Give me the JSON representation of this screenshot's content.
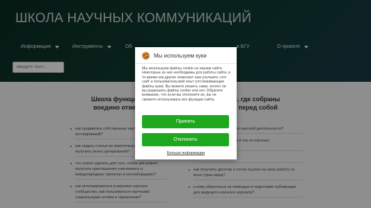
{
  "site": {
    "title": "ШКОЛА НАУЧНЫХ КОММУНИКАЦИЙ"
  },
  "nav": {
    "items": [
      {
        "label": "Информация"
      },
      {
        "label": "Инструменты"
      },
      {
        "label": "Об"
      },
      {
        "label": "в БГУ"
      },
      {
        "label": "О проекте"
      }
    ]
  },
  "search": {
    "placeholder": "Введите текст..."
  },
  "main": {
    "heading_line1": "Школа функциони                                          щник, где собраны",
    "heading_line2": "воедино ответы н                                          авит перед собой",
    "left_items": [
      "как продвигать собственные научные результаты исследований?",
      "как подать статью во влиятельный журнал и получить много цитирований?",
      "что нужно сделать для того, чтобы регулярно получать приглашения участвовать в международных проектах и коллаборациях?",
      "как интегрироваться в мировое научное сообщество, как пользоваться научными социальными сетями и гарнизоном?"
    ],
    "right_items": [
      "параметры используются научной деятельности?",
      "отличается от h-индекса и как он научных наукометрических",
      "что такое альтметрика?",
      "как получить десятки и сотни ссылок на свою работу со всех стран мира?",
      "к кому обратиться за помощью в подготовке публикации для ведущего научного журнала?"
    ]
  },
  "cookie_modal": {
    "title": "Мы используем куки",
    "body": "Мы используем файлы cookie на нашем сайте. Некоторые из них необходимы для работы сайта, в то время как другие помогают нам улучшить этот сайт и пользовательский опыт (отслеживающие файлы куки). Вы можете решить сами, хотите ли вы разрешить файлы cookie или нет. Обратите внимание, что если вы отклоните их, вы не сможете использовать все функции сайта.",
    "accept_label": "Принять",
    "decline_label": "Отклонить",
    "more_label": "Больше информации",
    "accent_color": "#1da81e"
  }
}
